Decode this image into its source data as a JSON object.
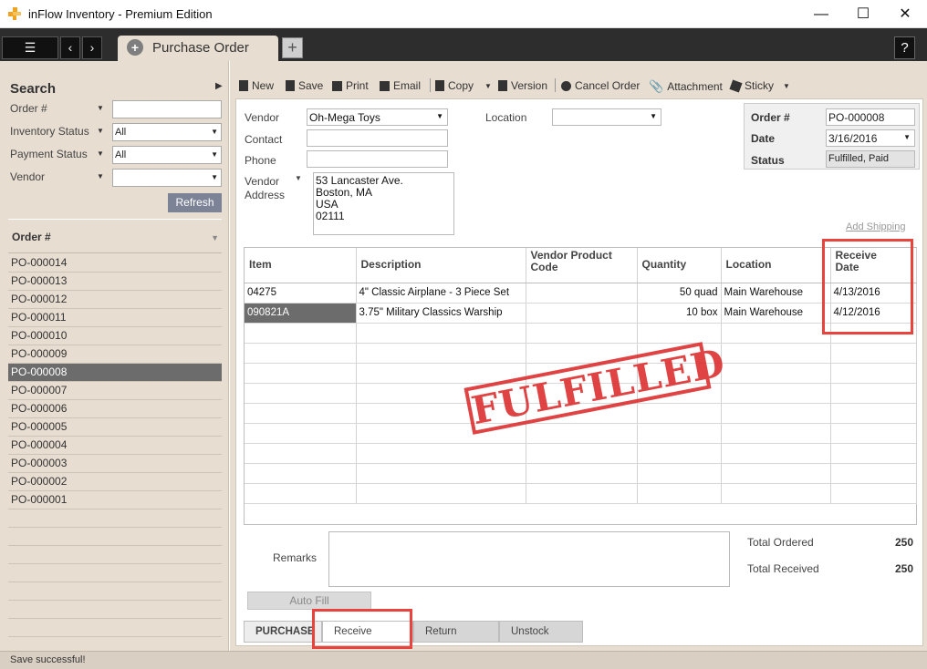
{
  "window": {
    "title": "inFlow Inventory - Premium Edition",
    "minimize": "—",
    "maximize": "☐",
    "close": "✕"
  },
  "tabs": {
    "menu_icon": "☰",
    "back": "‹",
    "forward": "›",
    "active_tab": "Purchase Order",
    "tab_icon": "+",
    "add_tab": "+",
    "help": "?"
  },
  "sidebar": {
    "search_title": "Search",
    "collapse": "▶",
    "filters": [
      {
        "label": "Order #",
        "value": ""
      },
      {
        "label": "Inventory Status",
        "value": "All"
      },
      {
        "label": "Payment Status",
        "value": "All"
      },
      {
        "label": "Vendor",
        "value": ""
      }
    ],
    "refresh": "Refresh",
    "list_header": "Order #",
    "orders": [
      "PO-000014",
      "PO-000013",
      "PO-000012",
      "PO-000011",
      "PO-000010",
      "PO-000009",
      "PO-000008",
      "PO-000007",
      "PO-000006",
      "PO-000005",
      "PO-000004",
      "PO-000003",
      "PO-000002",
      "PO-000001"
    ],
    "selected_order": "PO-000008"
  },
  "toolbar": {
    "new": "New",
    "save": "Save",
    "print": "Print",
    "email": "Email",
    "copy": "Copy",
    "version": "Version",
    "cancel_order": "Cancel Order",
    "attachment": "Attachment",
    "sticky": "Sticky"
  },
  "form": {
    "vendor_label": "Vendor",
    "vendor_value": "Oh-Mega Toys",
    "contact_label": "Contact",
    "contact_value": "",
    "phone_label": "Phone",
    "phone_value": "",
    "vendor_address_label": "Vendor",
    "vendor_address_label2": "Address",
    "address_lines": [
      "53 Lancaster Ave.",
      "Boston, MA",
      "USA",
      "02111"
    ],
    "location_label": "Location",
    "location_value": "",
    "order_no_label": "Order #",
    "order_no_value": "PO-000008",
    "date_label": "Date",
    "date_value": "3/16/2016",
    "status_label": "Status",
    "status_value": "Fulfilled, Paid",
    "add_shipping": "Add Shipping"
  },
  "grid": {
    "columns": [
      "Item",
      "Description",
      "Vendor Product Code",
      "Quantity",
      "Location",
      "Receive Date"
    ],
    "rows": [
      {
        "item": "04275",
        "description": "4\" Classic Airplane - 3 Piece Set",
        "code": "",
        "quantity": "50 quad",
        "location": "Main Warehouse",
        "receive_date": "4/13/2016"
      },
      {
        "item": "090821A",
        "description": "3.75\" Military Classics Warship",
        "code": "",
        "quantity": "10 box",
        "location": "Main Warehouse",
        "receive_date": "4/12/2016"
      }
    ],
    "stamp": "FULFILLED"
  },
  "footer": {
    "remarks_label": "Remarks",
    "total_ordered_label": "Total Ordered",
    "total_ordered_value": "250",
    "total_received_label": "Total Received",
    "total_received_value": "250",
    "autofill": "Auto Fill",
    "bottom_tabs": [
      "PURCHASE",
      "Receive",
      "Return",
      "Unstock"
    ]
  },
  "status_bar": {
    "message": "Save successful!"
  },
  "colors": {
    "highlight": "#e8443d",
    "stamp": "#dd2f2f",
    "panel": "#e7ddd1"
  }
}
